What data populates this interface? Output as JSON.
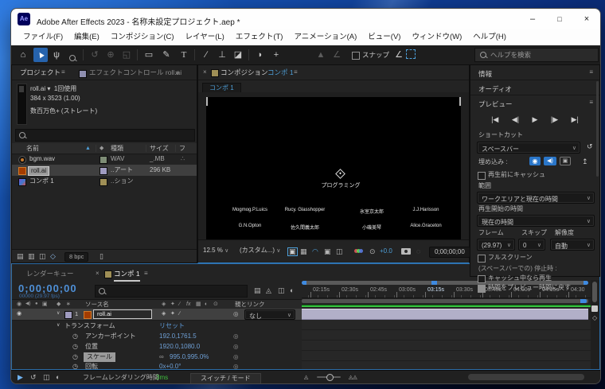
{
  "colors": {
    "accent": "#3f8ae0",
    "value-blue": "#6fa0d6",
    "time-blue": "#4e8fd6",
    "cache-green": "#35c13f",
    "layer-bar": "#b2afc8",
    "swatch-lavender": "#a09cc0",
    "swatch-tan": "#9f8f56",
    "swatch-green": "#7e8d76",
    "render-green": "#3fbf3f"
  },
  "titlebar": {
    "app_icon": "Ae",
    "title": "Adobe After Effects 2023 - 名称未設定プロジェクト.aep *",
    "minimize": "–",
    "maximize": "□",
    "close": "×"
  },
  "menu": {
    "items": [
      "ファイル(F)",
      "編集(E)",
      "コンポジション(C)",
      "レイヤー(L)",
      "エフェクト(T)",
      "アニメーション(A)",
      "ビュー(V)",
      "ウィンドウ(W)",
      "ヘルプ(H)"
    ]
  },
  "toolbar": {
    "snap": "スナップ",
    "help_search": "ヘルプを検索"
  },
  "project": {
    "tab": "プロジェクト",
    "tab_effects": "エフェクトコントロール roll.ai",
    "preview": {
      "name": "roll.ai",
      "usage": "1回使用",
      "dims": "384 x 3523 (1.00)",
      "depth": "数百万色+ (ストレート)"
    },
    "cols": {
      "name": "名前",
      "kind": "種類",
      "size": "サイズ",
      "path": "フ"
    },
    "rows": [
      {
        "name": "bgm.wav",
        "kind": "WAV",
        "size": "_.MB"
      },
      {
        "name": "roll.ai",
        "kind": "..アート",
        "size": "296 KB"
      },
      {
        "name": "コンポ 1",
        "kind": "..ション",
        "size": ""
      }
    ],
    "bpc": "8 bpc"
  },
  "comp": {
    "tab_label": "コンポジション",
    "tab_name": "コンポ 1",
    "viewer_tab": "コンポ 1",
    "center_text": "プログラミング",
    "credits": [
      [
        "Mogmog.P.Luics",
        "Rucy. Glasshopper",
        "氷室京太郎",
        "J.J.Harisson"
      ],
      [
        "G.N.Opton",
        "佐久間義太郎",
        "小磯美琴",
        "Alice.Graceton"
      ]
    ],
    "zoom": "12.5 %",
    "resolution": "(カスタム...)",
    "exposure": "+0.0",
    "timecode": "0;00;00;00"
  },
  "preview_panel": {
    "info": "情報",
    "audio": "オーディオ",
    "preview": "プレビュー",
    "shortcut_label": "ショートカット",
    "shortcut": "スペースバー",
    "include": "埋め込み :",
    "cache_before_play": "再生前にキャッシュ",
    "range_label": "範囲",
    "range": "ワークエリアと現在の時間",
    "start_label": "再生開始の時間",
    "start": "現在の時間",
    "frame_label": "フレーム",
    "skip_label": "スキップ",
    "resolution_label": "解像度",
    "frame_rate": "(29.97)",
    "skip": "0",
    "resolution": "自動",
    "fullscreen": "フルスクリーン",
    "on_stop": "(スペースバーでの) 停止時 :",
    "play_cached": "キャッシュ中なら再生",
    "restore_time": "時間をプレビュー時間に戻す"
  },
  "timeline": {
    "tab_render_queue": "レンダーキュー",
    "tab_comp": "コンポ 1",
    "timecode": "0;00;00;00",
    "frames": "00000 (29.97 fps)",
    "col_source": "ソース名",
    "col_parent": "親とリンク",
    "fx": "fx",
    "layer": {
      "index": "1",
      "name": "roll.ai",
      "parent": "なし"
    },
    "group": "トランスフォーム",
    "reset": "リセット",
    "props": [
      {
        "label": "アンカーポイント",
        "value": "192.0,1761.5"
      },
      {
        "label": "位置",
        "value": "1920.0,1080.0"
      },
      {
        "label": "スケール",
        "value": "995.0,995.0%"
      },
      {
        "label": "回転",
        "value": "0x+0.0°"
      }
    ],
    "ticks": [
      "02:15s",
      "02:30s",
      "02:45s",
      "03:00s",
      "03:15s",
      "03:30s",
      "03:45s",
      "04:00s",
      "04:15s",
      "04:30"
    ],
    "render_label": "フレームレンダリング時間",
    "render_time": "3ms",
    "switches": "スイッチ / モード"
  },
  "icons": {
    "burger": "≡",
    "overflow": "»",
    "chevron": "∨",
    "sort_asc": "▲",
    "close": "×",
    "eye": "◉",
    "audio": "◀)",
    "solo": "●",
    "lock": "▣",
    "tag": "◆",
    "flag": "∗",
    "stopwatch": "◷",
    "pickwhip": "◎",
    "link": "∞",
    "home": "⌂",
    "selection": "▲",
    "hand": "ψ",
    "rotate": "↺",
    "orbit": "⊕",
    "pan": "◱",
    "rect": "▭",
    "pen": "✎",
    "type": "T",
    "brush": "∕",
    "stamp": "⊥",
    "eraser": "◪",
    "roto": "◗",
    "puppet": "+",
    "mask_group": "▲",
    "angle": "∠",
    "first": "|◀",
    "prev": "◀|",
    "play": "▶",
    "next": "|▶",
    "last": "▶|",
    "reset_arrow": "↺",
    "export": "↥",
    "trash": "▯",
    "tree": "∴",
    "collapse": "◈",
    "quality": "✦",
    "slash": "∕",
    "blend": "▦",
    "blur": "◐",
    "exposure": "⊙",
    "region": "▣",
    "grid": "▦",
    "mask_vis": "◠",
    "roi": "▣",
    "guides": "◫",
    "ghost": "◌",
    "flowchart": "▤",
    "draft": "◬",
    "frameblend": "◫",
    "motionblur": "◐",
    "graphed": "◇",
    "live": "▶",
    "shy2": "↺",
    "fb2": "◫",
    "mb2": "◐",
    "interp": "▤",
    "folder": "▥",
    "newcomp": "◫",
    "proj_flow": "▤",
    "wand": "◇",
    "mtn_small": "◬",
    "mtn_big": "◬◬"
  }
}
